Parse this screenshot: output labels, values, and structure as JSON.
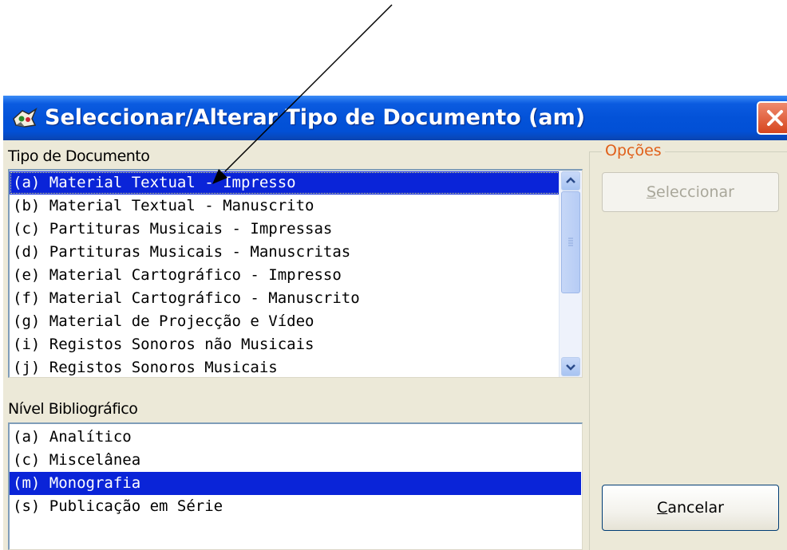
{
  "window": {
    "title": "Seleccionar/Alterar Tipo de Documento (am)"
  },
  "document_type": {
    "label": "Tipo de Documento",
    "items": [
      "(a) Material Textual - Impresso",
      "(b) Material Textual - Manuscrito",
      "(c) Partituras Musicais - Impressas",
      "(d) Partituras Musicais - Manuscritas",
      "(e) Material Cartográfico - Impresso",
      "(f) Material Cartográfico - Manuscrito",
      "(g) Material de Projecção e Vídeo",
      "(i) Registos Sonoros não Musicais",
      "(j) Registos Sonoros Musicais"
    ],
    "selected": "(a) Material Textual - Impresso"
  },
  "bibliographic_level": {
    "label": "Nível Bibliográfico",
    "items": [
      "(a) Analítico",
      "(c) Miscelânea",
      "(m) Monografia",
      "(s) Publicação em Série"
    ],
    "selected": "(m) Monografia"
  },
  "options": {
    "label": "Opções",
    "select_button_first": "S",
    "select_button_rest": "eleccionar",
    "cancel_button_first": "C",
    "cancel_button_rest": "ancelar"
  },
  "colors": {
    "titlebar": "#0352d8",
    "selection": "#0a24d8",
    "group_title": "#e0601a",
    "dialog_background": "#ece9d8"
  }
}
